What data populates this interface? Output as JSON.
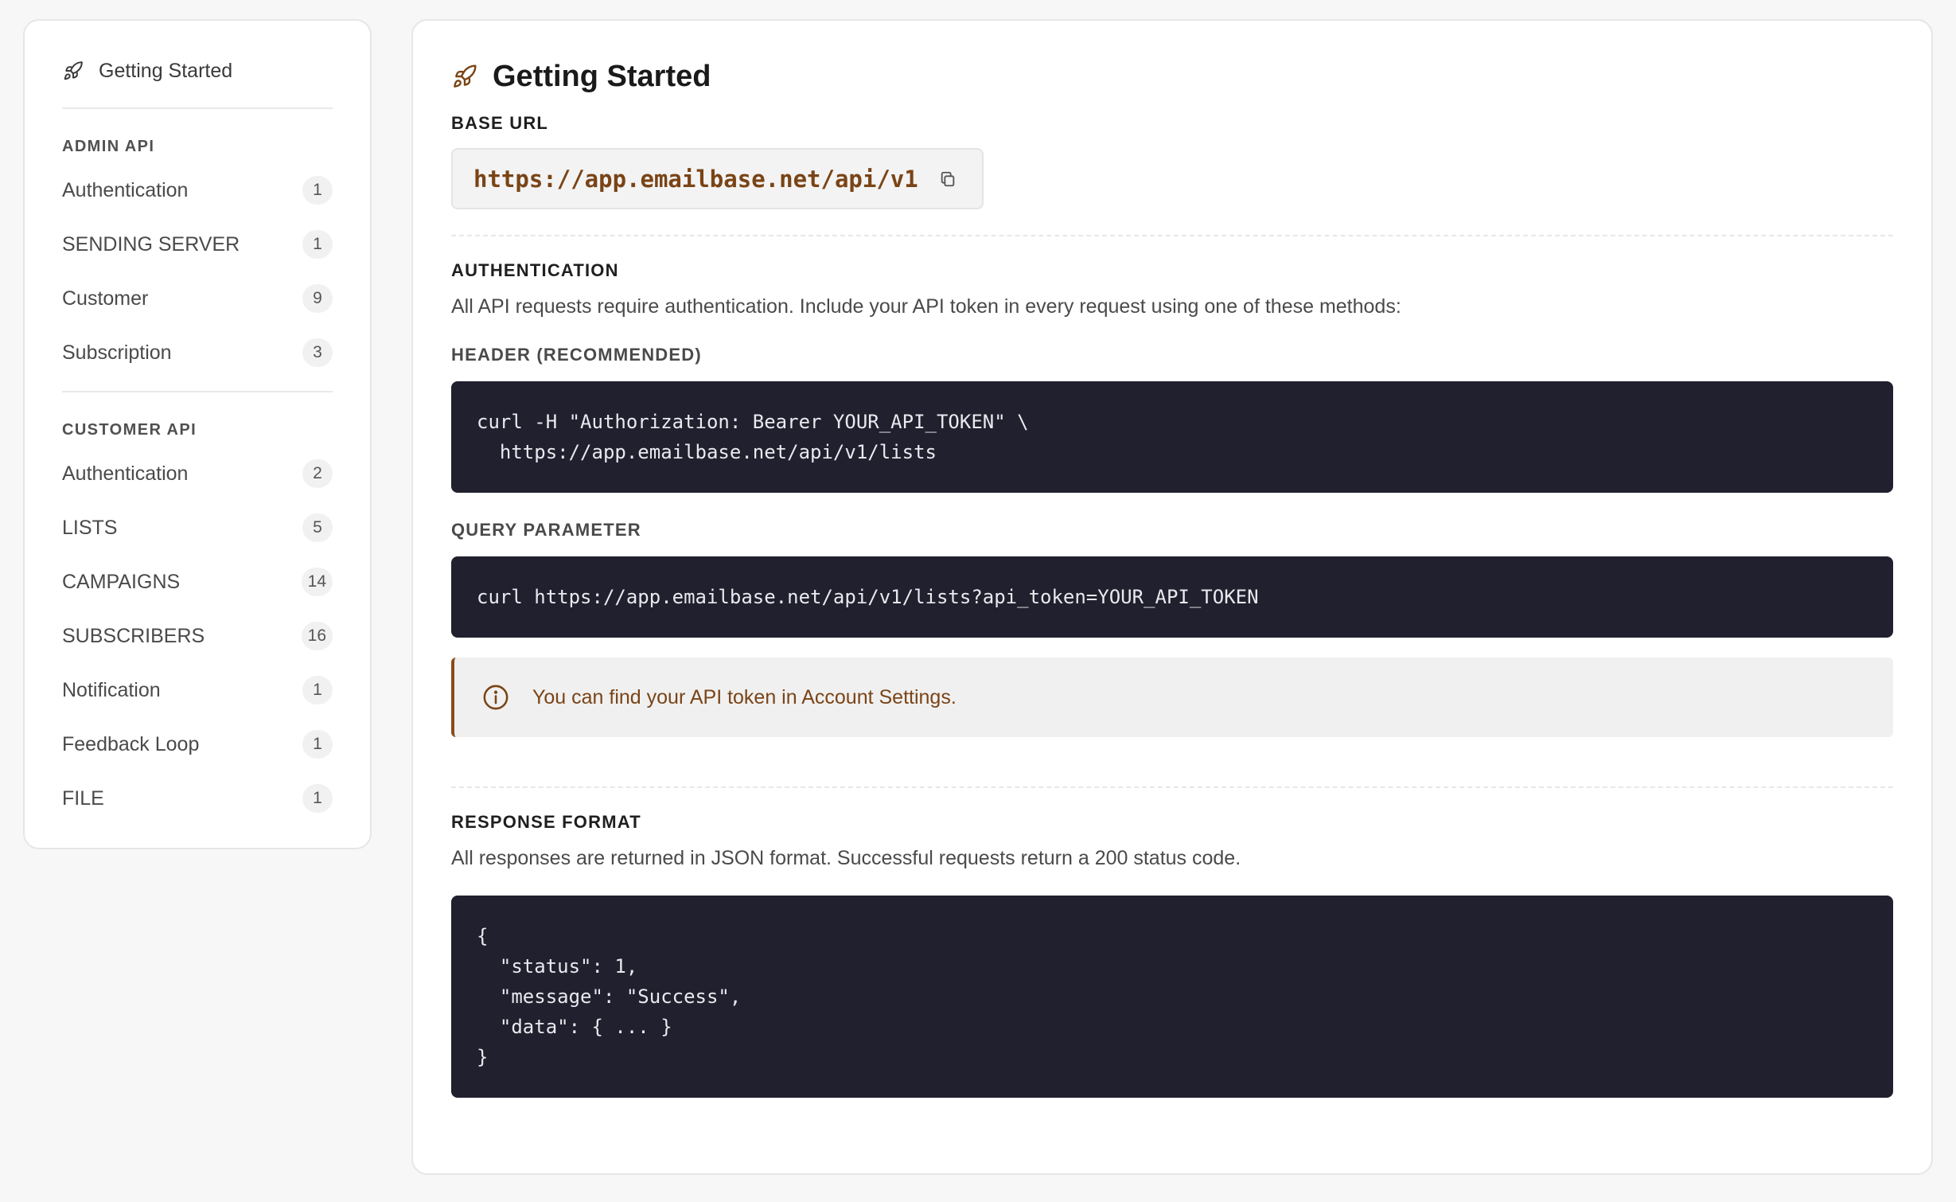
{
  "colors": {
    "accent": "#7a4416",
    "code_bg": "#20202e",
    "page_bg": "#f7f7f7"
  },
  "sidebar": {
    "top_item": {
      "label": "Getting Started",
      "icon": "rocket-icon"
    },
    "sections": [
      {
        "title": "ADMIN API",
        "items": [
          {
            "label": "Authentication",
            "count": "1"
          },
          {
            "label": "SENDING SERVER",
            "count": "1"
          },
          {
            "label": "Customer",
            "count": "9"
          },
          {
            "label": "Subscription",
            "count": "3"
          }
        ]
      },
      {
        "title": "CUSTOMER API",
        "items": [
          {
            "label": "Authentication",
            "count": "2"
          },
          {
            "label": "LISTS",
            "count": "5"
          },
          {
            "label": "CAMPAIGNS",
            "count": "14"
          },
          {
            "label": "SUBSCRIBERS",
            "count": "16"
          },
          {
            "label": "Notification",
            "count": "1"
          },
          {
            "label": "Feedback Loop",
            "count": "1"
          },
          {
            "label": "FILE",
            "count": "1"
          }
        ]
      }
    ]
  },
  "main": {
    "title": "Getting Started",
    "title_icon": "rocket-icon",
    "base_url": {
      "label": "BASE URL",
      "value": "https://app.emailbase.net/api/v1",
      "copy_icon": "copy-icon"
    },
    "authentication": {
      "label": "AUTHENTICATION",
      "description": "All API requests require authentication. Include your API token in every request using one of these methods:",
      "header_label": "HEADER (RECOMMENDED)",
      "header_code": "curl -H \"Authorization: Bearer YOUR_API_TOKEN\" \\\n  https://app.emailbase.net/api/v1/lists",
      "query_label": "QUERY PARAMETER",
      "query_code": "curl https://app.emailbase.net/api/v1/lists?api_token=YOUR_API_TOKEN",
      "info_icon": "info-icon",
      "info_text": "You can find your API token in Account Settings."
    },
    "response": {
      "label": "RESPONSE FORMAT",
      "description": "All responses are returned in JSON format. Successful requests return a 200 status code.",
      "code": "{\n  \"status\": 1,\n  \"message\": \"Success\",\n  \"data\": { ... }\n}"
    }
  }
}
